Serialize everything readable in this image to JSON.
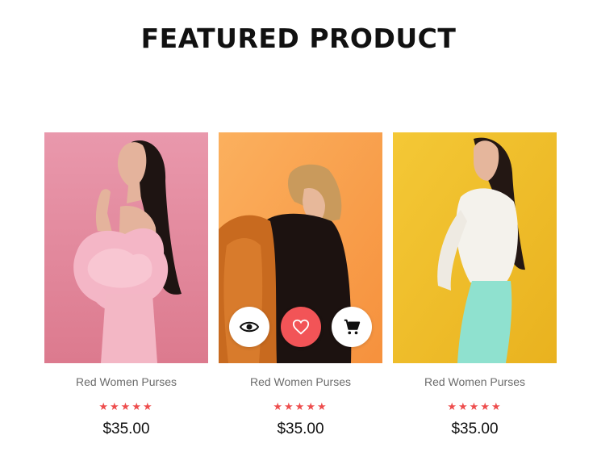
{
  "section": {
    "title": "FEATURED PRODUCT"
  },
  "products": [
    {
      "name": "Red Women Purses",
      "price": "$35.00",
      "rating": 5,
      "stars": "★★★★★",
      "image": "woman-pink-dress-photo",
      "background": "#e2879a"
    },
    {
      "name": "Red Women Purses",
      "price": "$35.00",
      "rating": 5,
      "stars": "★★★★★",
      "image": "woman-orange-jacket-photo",
      "background": "#f8a552",
      "actions": [
        {
          "icon": "eye-icon",
          "label": "quick view"
        },
        {
          "icon": "heart-icon",
          "label": "wishlist"
        },
        {
          "icon": "cart-icon",
          "label": "add to cart"
        }
      ]
    },
    {
      "name": "Red Women Purses",
      "price": "$35.00",
      "rating": 5,
      "stars": "★★★★★",
      "image": "woman-white-blouse-photo",
      "background": "#f0c02b"
    }
  ],
  "colors": {
    "accent": "#f25457",
    "star": "#ee4d4d",
    "title": "#111111",
    "name_text": "#6b6b6b"
  }
}
